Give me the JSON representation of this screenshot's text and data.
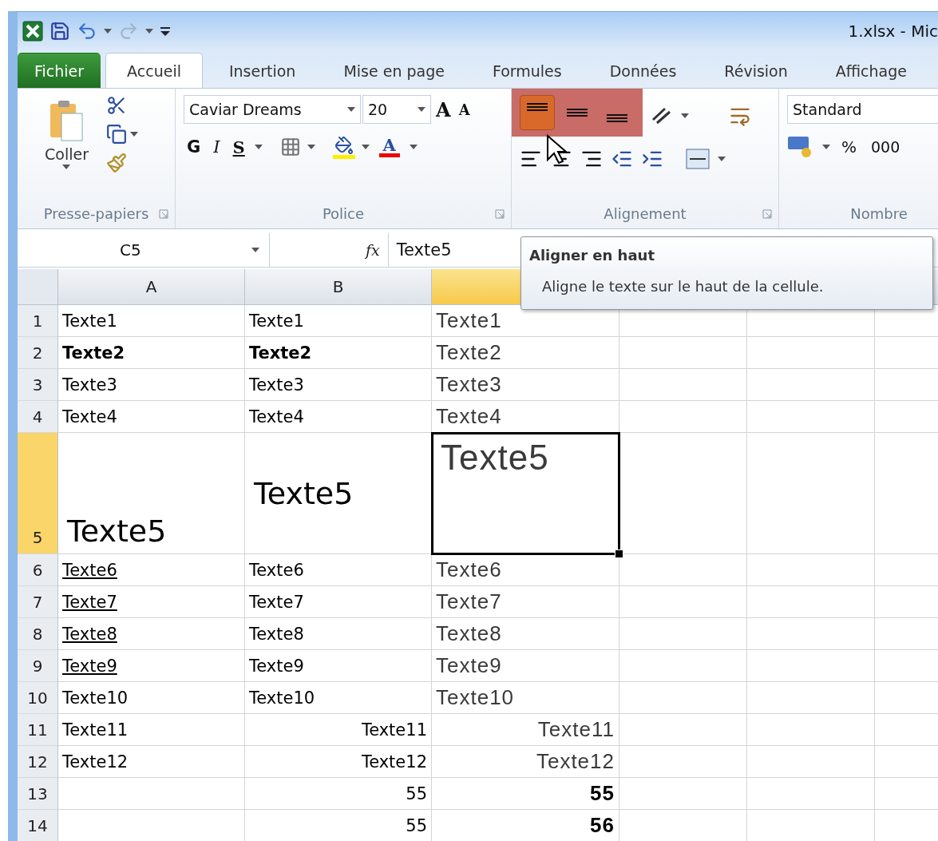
{
  "window": {
    "title": "1.xlsx - Mic"
  },
  "tabs": [
    {
      "label": "Fichier",
      "kind": "file",
      "selected": false
    },
    {
      "label": "Accueil",
      "kind": "tab",
      "selected": true
    },
    {
      "label": "Insertion",
      "kind": "tab",
      "selected": false
    },
    {
      "label": "Mise en page",
      "kind": "tab",
      "selected": false
    },
    {
      "label": "Formules",
      "kind": "tab",
      "selected": false
    },
    {
      "label": "Données",
      "kind": "tab",
      "selected": false
    },
    {
      "label": "Révision",
      "kind": "tab",
      "selected": false
    },
    {
      "label": "Affichage",
      "kind": "tab",
      "selected": false
    }
  ],
  "ribbon": {
    "clipboard": {
      "paste_label": "Coller",
      "group_label": "Presse-papiers"
    },
    "font": {
      "name": "Caviar Dreams",
      "size": "20",
      "grow_label": "A",
      "shrink_label": "A",
      "bold_label": "G",
      "italic_label": "I",
      "underline_label": "S",
      "color_label": "A",
      "group_label": "Police"
    },
    "alignment": {
      "group_label": "Alignement",
      "vertical": [
        {
          "kind": "top",
          "selected": true
        },
        {
          "kind": "middle",
          "selected": false
        },
        {
          "kind": "bottom",
          "selected": false
        }
      ]
    },
    "number": {
      "format": "Standard",
      "percent": "%",
      "thousands": "000",
      "group_label": "Nombre"
    }
  },
  "formula_bar": {
    "name_box": "C5",
    "function_label": "fx",
    "value": "Texte5"
  },
  "tooltip": {
    "title": "Aligner en haut",
    "description": "Aligne le texte sur le haut de la cellule."
  },
  "columns": [
    {
      "label": "A",
      "selected": false
    },
    {
      "label": "B",
      "selected": false
    },
    {
      "selected": true
    }
  ],
  "rows": [
    {
      "number": "1",
      "selected": false,
      "cells": [
        {
          "text": "Texte1",
          "selected": false
        },
        {
          "text": "Texte1",
          "selected": false
        },
        {
          "text": "Texte1",
          "selected": false
        }
      ]
    },
    {
      "number": "2",
      "selected": false,
      "cells": [
        {
          "text": "Texte2",
          "bold": true,
          "selected": false
        },
        {
          "text": "Texte2",
          "bold": true,
          "selected": false
        },
        {
          "text": "Texte2",
          "selected": false
        }
      ]
    },
    {
      "number": "3",
      "selected": false,
      "cells": [
        {
          "text": "Texte3",
          "selected": false
        },
        {
          "text": "Texte3",
          "selected": false
        },
        {
          "text": "Texte3",
          "selected": false
        }
      ]
    },
    {
      "number": "4",
      "selected": false,
      "cells": [
        {
          "text": "Texte4",
          "selected": false
        },
        {
          "text": "Texte4",
          "selected": false
        },
        {
          "text": "Texte4",
          "selected": false
        }
      ]
    },
    {
      "number": "5",
      "selected": true,
      "tall": true,
      "cells": [
        {
          "text": "Texte5",
          "selected": false
        },
        {
          "text": "Texte5",
          "v_middle": true,
          "selected": false
        },
        {
          "text": "Texte5",
          "v_top": true,
          "selected": true
        }
      ]
    },
    {
      "number": "6",
      "selected": false,
      "cells": [
        {
          "text": "Texte6",
          "underline": true,
          "selected": false
        },
        {
          "text": "Texte6",
          "selected": false
        },
        {
          "text": "Texte6",
          "selected": false
        }
      ]
    },
    {
      "number": "7",
      "selected": false,
      "cells": [
        {
          "text": "Texte7",
          "underline": true,
          "selected": false
        },
        {
          "text": "Texte7",
          "selected": false
        },
        {
          "text": "Texte7",
          "selected": false
        }
      ]
    },
    {
      "number": "8",
      "selected": false,
      "cells": [
        {
          "text": "Texte8",
          "underline": true,
          "selected": false
        },
        {
          "text": "Texte8",
          "selected": false
        },
        {
          "text": "Texte8",
          "selected": false
        }
      ]
    },
    {
      "number": "9",
      "selected": false,
      "cells": [
        {
          "text": "Texte9",
          "underline": true,
          "selected": false
        },
        {
          "text": "Texte9",
          "selected": false
        },
        {
          "text": "Texte9",
          "selected": false
        }
      ]
    },
    {
      "number": "10",
      "selected": false,
      "cells": [
        {
          "text": "Texte10",
          "selected": false
        },
        {
          "text": "Texte10",
          "selected": false
        },
        {
          "text": "Texte10",
          "selected": false
        }
      ]
    },
    {
      "number": "11",
      "selected": false,
      "cells": [
        {
          "text": "Texte11",
          "selected": false
        },
        {
          "text": "Texte11",
          "align_right": true,
          "selected": false
        },
        {
          "text": "Texte11",
          "align_right": true,
          "selected": false
        }
      ]
    },
    {
      "number": "12",
      "selected": false,
      "cells": [
        {
          "text": "Texte12",
          "selected": false
        },
        {
          "text": "Texte12",
          "align_right": true,
          "selected": false
        },
        {
          "text": "Texte12",
          "align_right": true,
          "selected": false
        }
      ]
    },
    {
      "number": "13",
      "selected": false,
      "cells": [
        {
          "selected": false
        },
        {
          "text": "55",
          "align_right": true,
          "selected": false
        },
        {
          "text": "55",
          "align_right": true,
          "bold": true,
          "selected": false
        }
      ]
    },
    {
      "number": "14",
      "selected": false,
      "cells": [
        {
          "selected": false
        },
        {
          "text": "55",
          "align_right": true,
          "selected": false
        },
        {
          "text": "56",
          "align_right": true,
          "bold": true,
          "selected": false
        }
      ]
    }
  ]
}
